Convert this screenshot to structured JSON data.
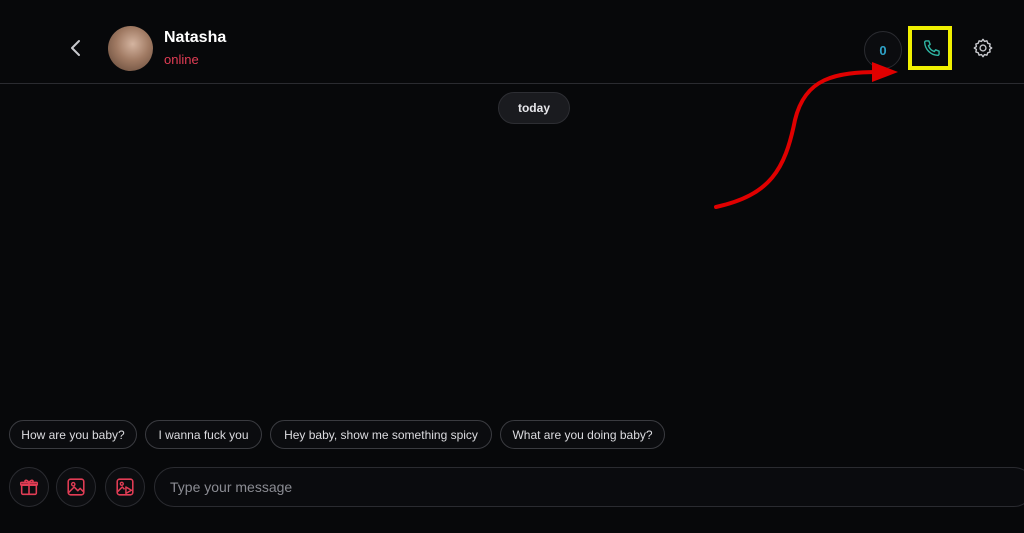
{
  "header": {
    "contact_name": "Natasha",
    "status": "online",
    "counter": "0",
    "back_icon": "chevron-left-icon",
    "call_icon": "phone-icon",
    "settings_icon": "gear-icon"
  },
  "chat": {
    "date_separator": "today"
  },
  "suggestions": [
    "How are you baby?",
    "I wanna fuck you",
    "Hey baby, show me something spicy",
    "What are you doing baby?"
  ],
  "composer": {
    "placeholder": "Type your message",
    "gift_icon": "gift-icon",
    "image_icon": "image-icon",
    "video_icon": "video-icon"
  },
  "colors": {
    "accent": "#e23d55",
    "counter": "#2ea3c9",
    "call": "#2fb5a3",
    "highlight": "#f0f000",
    "annotation_arrow": "#e00000"
  }
}
